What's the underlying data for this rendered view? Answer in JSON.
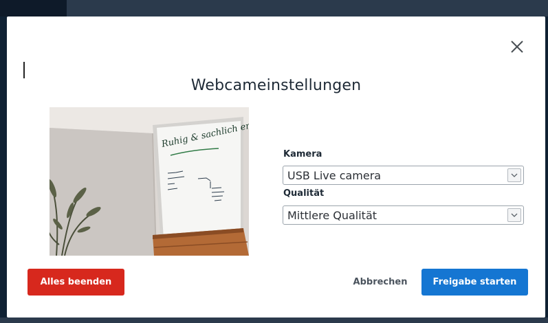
{
  "dialog": {
    "title": "Webcameinstellungen",
    "close_icon": "close-icon"
  },
  "camera": {
    "label": "Kamera",
    "selected": "USB Live camera"
  },
  "quality": {
    "label": "Qualität",
    "selected": "Mittlere Qualität"
  },
  "preview": {
    "flipchart_heading": "Ruhig & sachlich erklären"
  },
  "buttons": {
    "end_all": "Alles beenden",
    "cancel": "Abbrechen",
    "start_sharing": "Freigabe starten"
  },
  "colors": {
    "danger": "#d7281d",
    "primary": "#1576d2"
  }
}
